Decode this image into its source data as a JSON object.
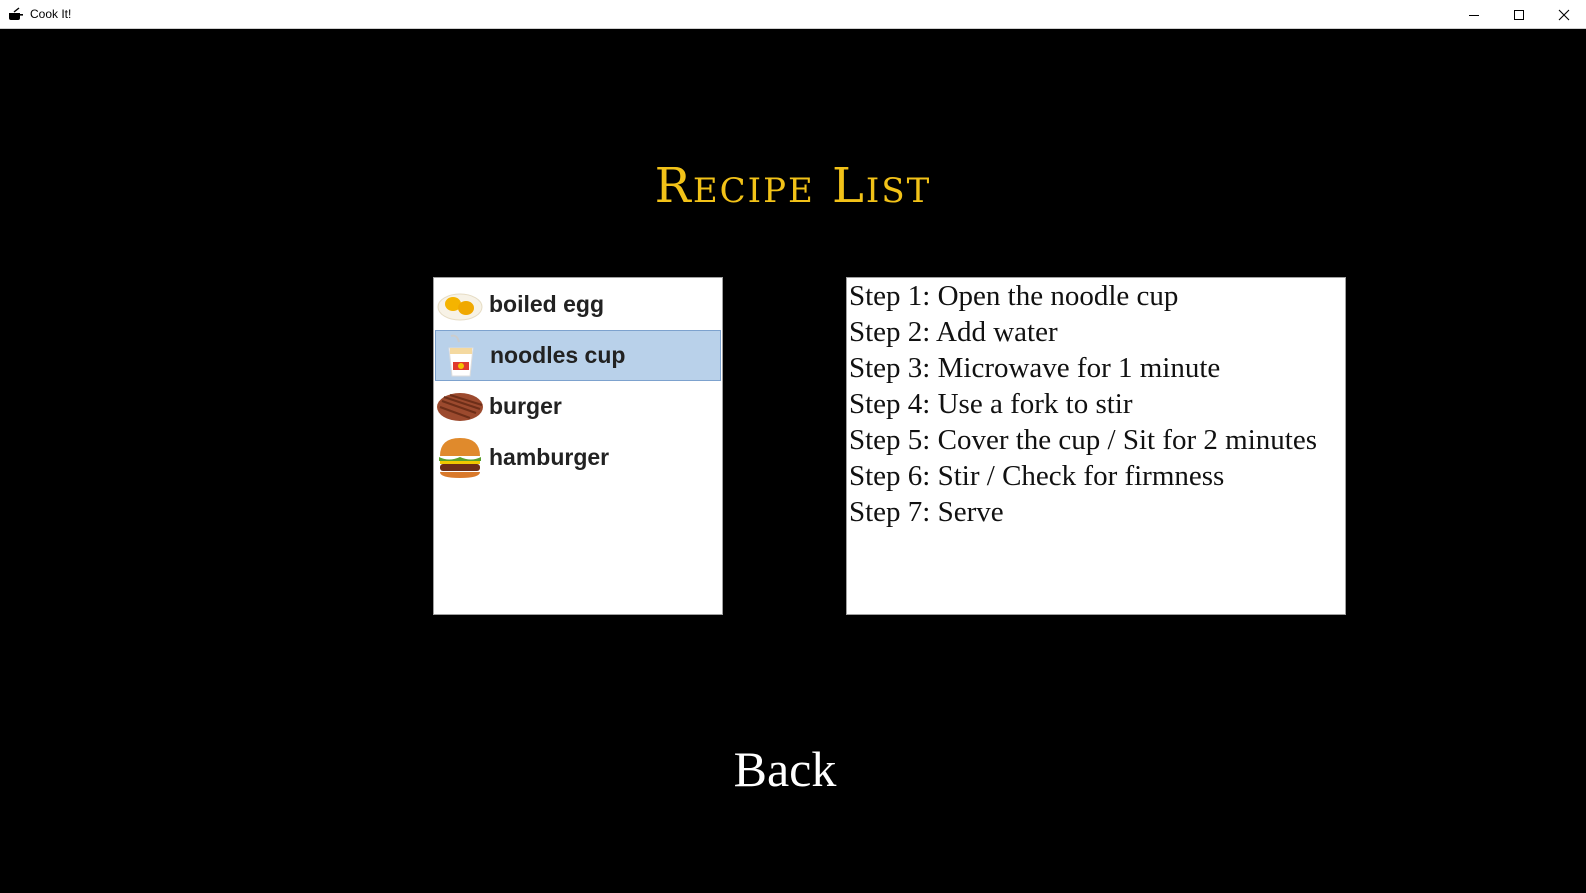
{
  "window": {
    "title": "Cook It!"
  },
  "heading": "Recipe List",
  "recipes": [
    {
      "label": "boiled egg",
      "icon": "fried-egg-icon",
      "selected": false
    },
    {
      "label": "noodles cup",
      "icon": "noodle-cup-icon",
      "selected": true
    },
    {
      "label": "burger",
      "icon": "burger-patty-icon",
      "selected": false
    },
    {
      "label": "hamburger",
      "icon": "hamburger-icon",
      "selected": false
    }
  ],
  "steps": [
    "Step 1: Open the noodle cup",
    "Step 2: Add water",
    "Step 3: Microwave for 1 minute",
    "Step 4: Use a fork to stir",
    "Step 5: Cover the cup / Sit for 2 minutes",
    "Step 6: Stir / Check for firmness",
    "Step 7: Serve"
  ],
  "back_label": "Back",
  "colors": {
    "background": "#000000",
    "heading": "#f2c218",
    "selection": "#b9d1ea"
  }
}
